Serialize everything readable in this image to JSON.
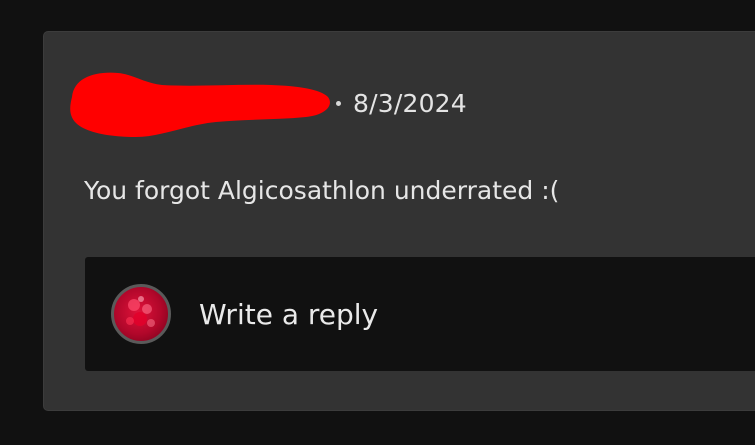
{
  "comment": {
    "date": "8/3/2024",
    "separator": "•",
    "body": "You forgot Algicosathlon underrated :("
  },
  "reply": {
    "placeholder": "Write a reply",
    "avatar_icon": "user-avatar-icon"
  },
  "colors": {
    "page_background": "#111111",
    "card_background": "#333333",
    "reply_background": "#111111",
    "redaction": "#ff0000",
    "avatar_red": "#c8102e"
  }
}
